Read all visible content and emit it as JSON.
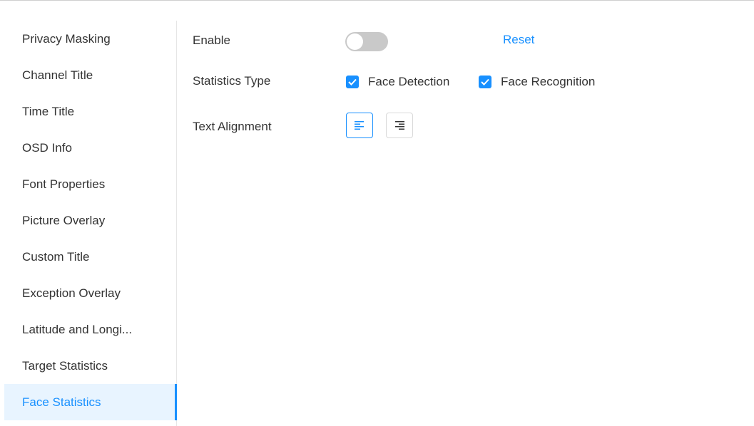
{
  "sidebar": {
    "items": [
      {
        "label": "Privacy Masking"
      },
      {
        "label": "Channel Title"
      },
      {
        "label": "Time Title"
      },
      {
        "label": "OSD Info"
      },
      {
        "label": "Font Properties"
      },
      {
        "label": "Picture Overlay"
      },
      {
        "label": "Custom Title"
      },
      {
        "label": "Exception Overlay"
      },
      {
        "label": "Latitude and Longi..."
      },
      {
        "label": "Target Statistics"
      },
      {
        "label": "Face Statistics",
        "active": true
      }
    ]
  },
  "form": {
    "enable": {
      "label": "Enable",
      "value": false
    },
    "reset_label": "Reset",
    "statistics_type": {
      "label": "Statistics Type",
      "options": [
        {
          "label": "Face Detection",
          "checked": true
        },
        {
          "label": "Face Recognition",
          "checked": true
        }
      ]
    },
    "text_alignment": {
      "label": "Text Alignment",
      "options": [
        {
          "icon": "align-left-icon",
          "selected": true
        },
        {
          "icon": "align-right-icon",
          "selected": false
        }
      ]
    }
  },
  "colors": {
    "accent": "#1890ff",
    "active_bg": "#e8f4ff",
    "toggle_off": "#c9c9c9",
    "text": "#333333"
  }
}
